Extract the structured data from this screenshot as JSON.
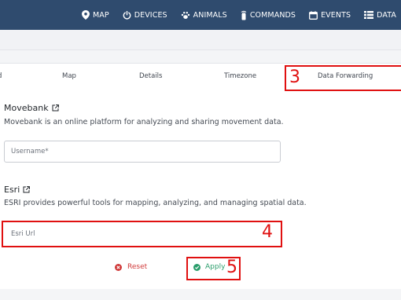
{
  "nav": {
    "items": [
      {
        "label": "MAP",
        "icon": "map-pin-icon"
      },
      {
        "label": "DEVICES",
        "icon": "power-icon"
      },
      {
        "label": "ANIMALS",
        "icon": "paw-icon"
      },
      {
        "label": "COMMANDS",
        "icon": "tracker-icon"
      },
      {
        "label": "EVENTS",
        "icon": "calendar-icon"
      },
      {
        "label": "DATA",
        "icon": "table-icon"
      }
    ]
  },
  "tabs": {
    "items": [
      {
        "label": "d"
      },
      {
        "label": "Map"
      },
      {
        "label": "Details"
      },
      {
        "label": "Timezone"
      },
      {
        "label": "Data Forwarding"
      }
    ],
    "active": "Data Forwarding"
  },
  "annotations": {
    "m3": "3",
    "m4": "4",
    "m5": "5",
    "color": "#e01010"
  },
  "movebank": {
    "title": "Movebank",
    "description": "Movebank is an online platform for analyzing and sharing movement data.",
    "username_placeholder": "Username*",
    "username_value": ""
  },
  "esri": {
    "title": "Esri",
    "description": "ESRI provides powerful tools for mapping, analyzing, and managing spatial data.",
    "url_placeholder": "Esri Url",
    "url_value": ""
  },
  "actions": {
    "reset_label": "Reset",
    "apply_label": "Apply"
  },
  "colors": {
    "navbar": "#2f4b6e",
    "reset": "#d03a3a",
    "apply": "#2a9d6b"
  }
}
